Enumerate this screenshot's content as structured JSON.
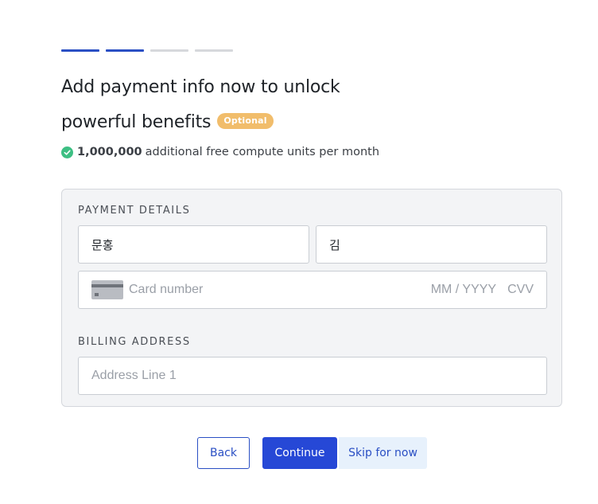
{
  "progress": {
    "steps": [
      {
        "state": "done"
      },
      {
        "state": "done"
      },
      {
        "state": "todo"
      },
      {
        "state": "todo"
      }
    ],
    "colors": {
      "done": "#2a4fc4",
      "todo": "#d6d8dc"
    }
  },
  "header": {
    "title_line1": "Add payment info now to unlock",
    "title_line2": "powerful benefits",
    "badge": "Optional"
  },
  "benefit": {
    "icon": "check-circle-icon",
    "amount": "1,000,000",
    "text": "additional free compute units per month"
  },
  "payment": {
    "section_label": "PAYMENT DETAILS",
    "first_name_value": "문홍",
    "last_name_value": "김",
    "card_icon": "credit-card-icon",
    "card_number_placeholder": "Card number",
    "expiry_placeholder": "MM / YYYY",
    "cvv_placeholder": "CVV"
  },
  "billing": {
    "section_label": "BILLING ADDRESS",
    "address_line1_placeholder": "Address Line 1"
  },
  "actions": {
    "back_label": "Back",
    "continue_label": "Continue",
    "skip_label": "Skip for now"
  },
  "colors": {
    "accent": "#2648d6",
    "badge": "#f1bd6b",
    "check": "#3dbf83",
    "skip_bg": "#e7f1fc"
  }
}
